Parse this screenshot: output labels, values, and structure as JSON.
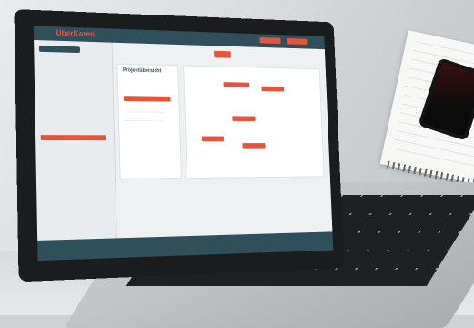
{
  "app": {
    "brand": "UberKaren"
  },
  "sidebar": {
    "items": [
      {
        "label": ""
      },
      {
        "label": ""
      },
      {
        "label": ""
      },
      {
        "label": ""
      },
      {
        "label": ""
      }
    ]
  },
  "tabs": [
    {
      "label": ""
    },
    {
      "label": ""
    },
    {
      "label": ""
    },
    {
      "label": ""
    },
    {
      "label": ""
    },
    {
      "label": ""
    }
  ],
  "page": {
    "title": "Projektübersicht"
  },
  "panels": [
    {
      "title": ""
    },
    {
      "title": ""
    }
  ]
}
